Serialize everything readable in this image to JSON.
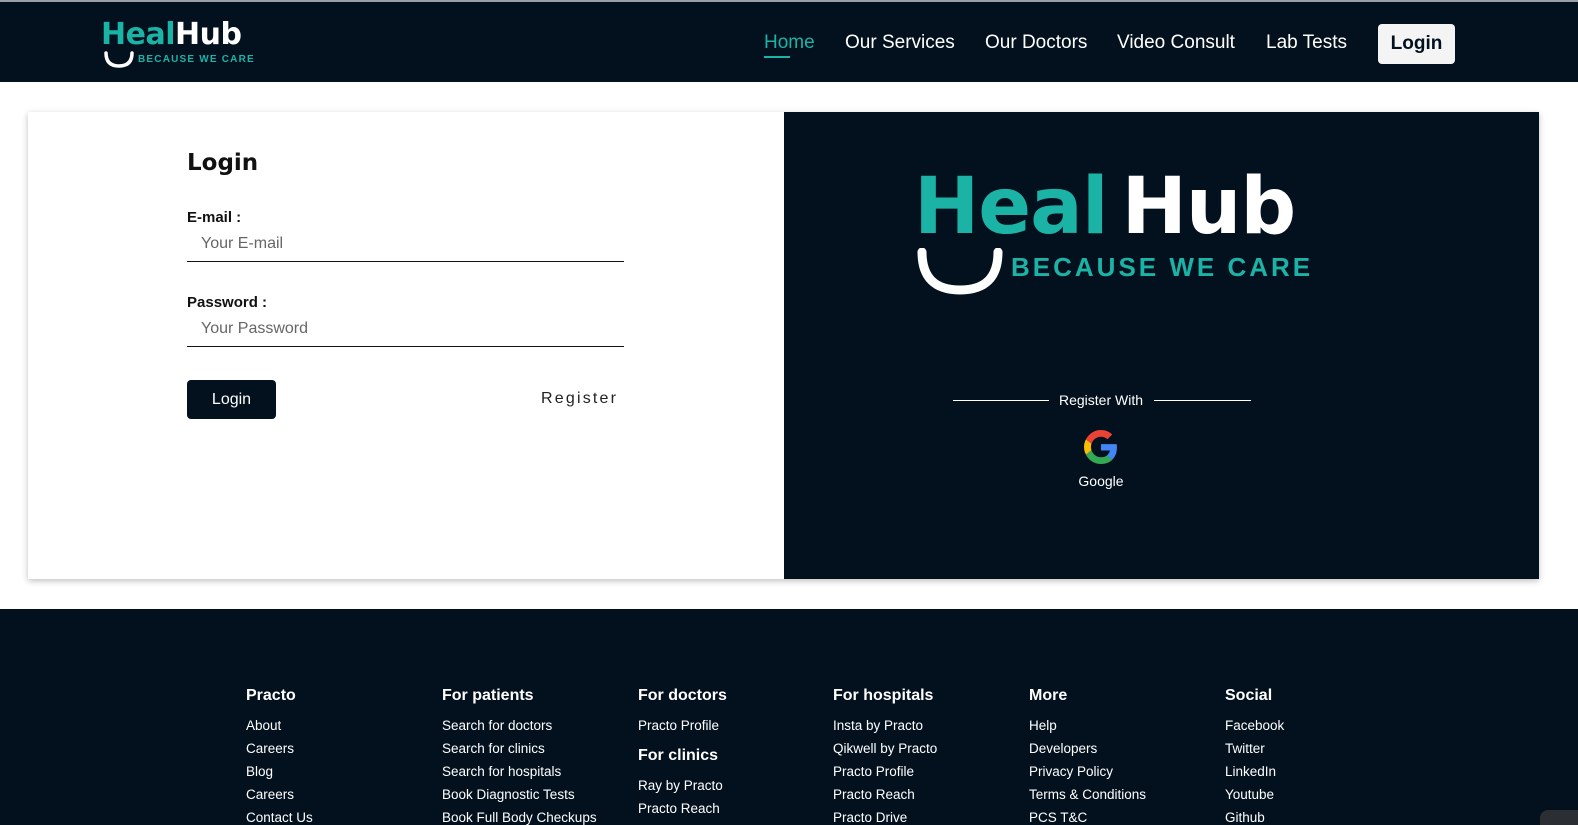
{
  "brand": {
    "heal": "Heal",
    "hub": "Hub",
    "tagline": "BECAUSE WE CARE"
  },
  "nav": {
    "items": [
      "Home",
      "Our Services",
      "Our Doctors",
      "Video Consult",
      "Lab Tests"
    ],
    "active": "Home",
    "login": "Login"
  },
  "login_form": {
    "title": "Login",
    "email_label": "E-mail :",
    "email_placeholder": "Your E-mail",
    "email_value": "",
    "password_label": "Password :",
    "password_placeholder": "Your Password",
    "password_value": "",
    "submit_label": "Login",
    "register_label": "Register"
  },
  "register_panel": {
    "register_with": "Register With",
    "google_label": "Google"
  },
  "footer": {
    "columns": [
      {
        "heading": "Practo",
        "items": [
          "About",
          "Careers",
          "Blog",
          "Careers",
          "Contact Us"
        ]
      },
      {
        "heading": "For patients",
        "items": [
          "Search for doctors",
          "Search for clinics",
          "Search for hospitals",
          "Book Diagnostic Tests",
          "Book Full Body Checkups"
        ]
      },
      {
        "heading": "For doctors",
        "items": [
          "Practo Profile"
        ],
        "sub_heading": "For clinics",
        "sub_items": [
          "Ray by Practo",
          "Practo Reach"
        ]
      },
      {
        "heading": "For hospitals",
        "items": [
          "Insta by Practo",
          "Qikwell by Practo",
          "Practo Profile",
          "Practo Reach",
          "Practo Drive"
        ]
      },
      {
        "heading": "More",
        "items": [
          "Help",
          "Developers",
          "Privacy Policy",
          "Terms & Conditions",
          "PCS T&C"
        ]
      },
      {
        "heading": "Social",
        "items": [
          "Facebook",
          "Twitter",
          "LinkedIn",
          "Youtube",
          "Github"
        ]
      }
    ]
  },
  "colors": {
    "navy": "#03111f",
    "teal": "#1bb3a6",
    "white": "#ffffff"
  }
}
